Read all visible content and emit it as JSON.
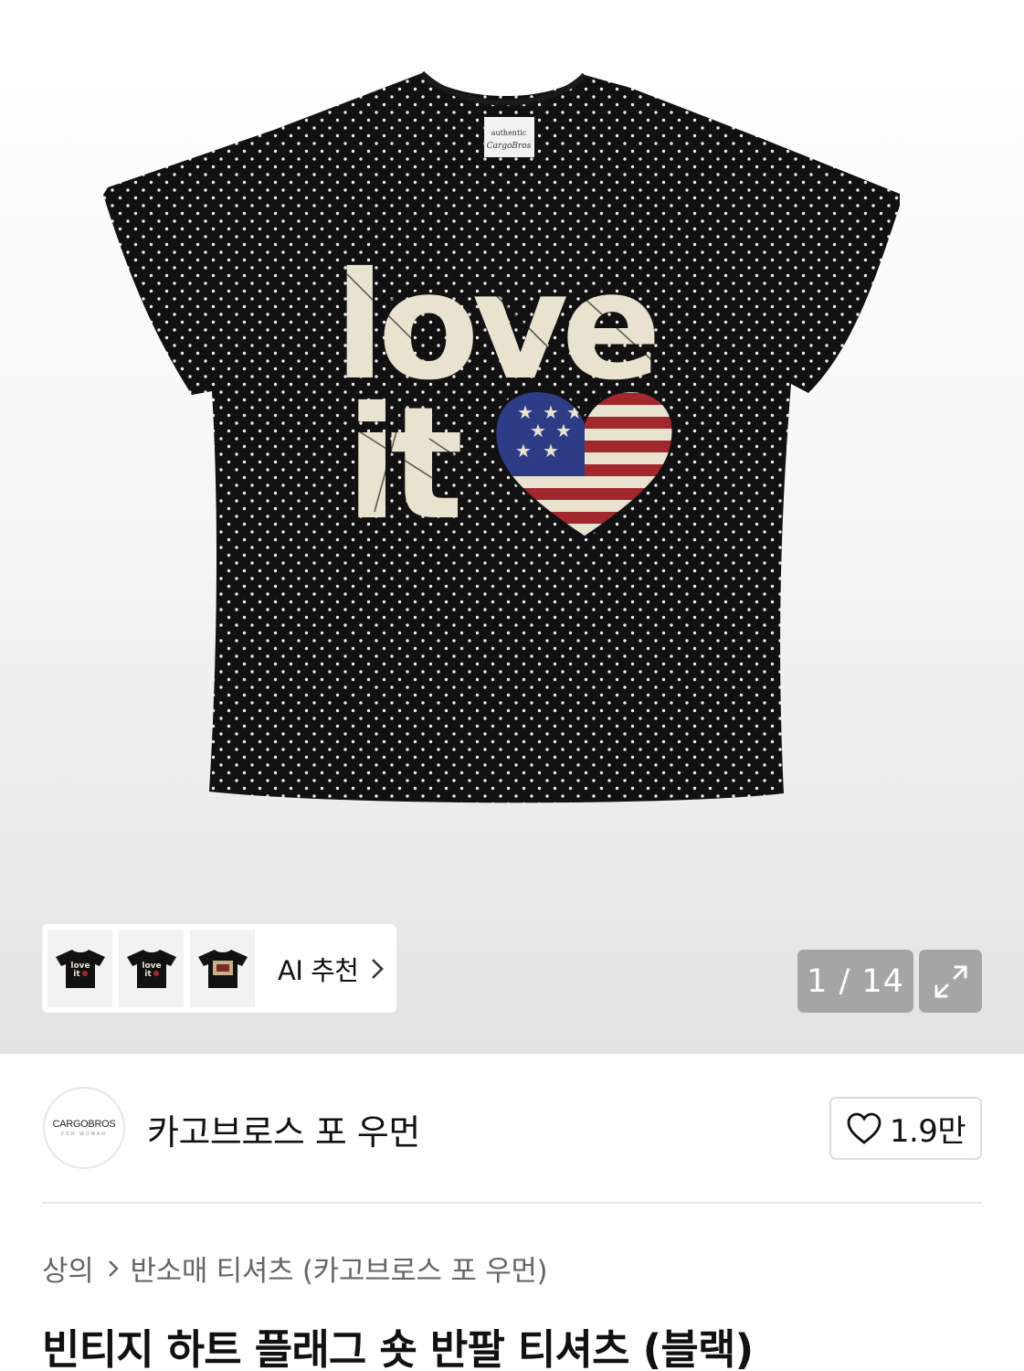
{
  "gallery": {
    "counter_current": "1",
    "counter_separator": "/",
    "counter_total": "14",
    "counter_text": "1 / 14",
    "ai_recommend_label": "AI 추천",
    "thumbnails": [
      "thumbnail-love-it-black",
      "thumbnail-love-it-black-2",
      "thumbnail-love-it-print"
    ]
  },
  "brand": {
    "logo_text": "CARGOBROS",
    "logo_subtext": "FOR WOMAN",
    "name": "카고브로스 포 우먼",
    "like_count": "1.9만"
  },
  "breadcrumb": {
    "category": "상의",
    "subcategory": "반소매 티셔츠 (카고브로스 포 우먼)"
  },
  "product": {
    "title": "빈티지 하트 플래그 숏 반팔 티셔츠 (블랙)",
    "print_line1": "love",
    "print_line2": "it",
    "tag_text": "authentic"
  },
  "colors": {
    "shirt": "#111111",
    "print": "#e8e2cf",
    "flag_red": "#a3282d",
    "flag_blue": "#2e3c86",
    "accent_text": "#111111",
    "muted_text": "#666666"
  }
}
